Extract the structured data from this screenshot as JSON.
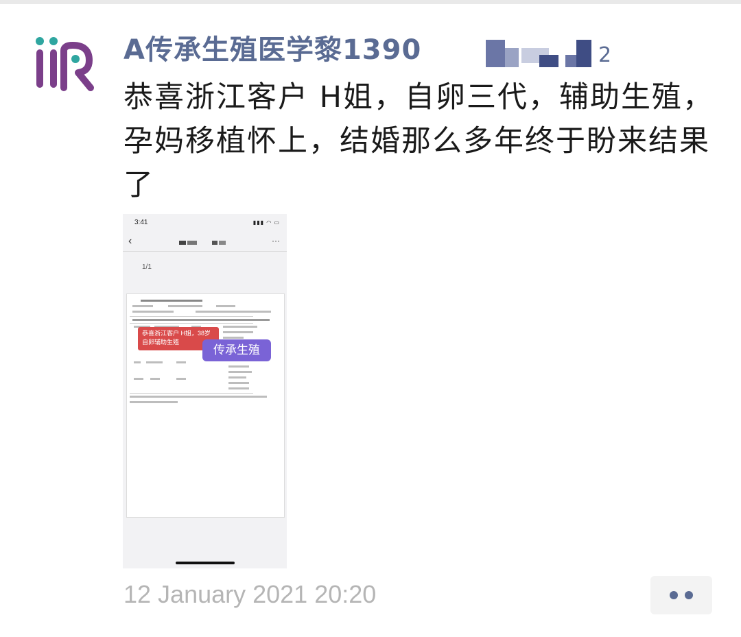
{
  "post": {
    "author": "A传承生殖医学黎1390",
    "text": "恭喜浙江客户 H姐，自卵三代，辅助生殖，孕妈移植怀上，结婚那么多年终于盼来结果了",
    "timestamp": "12 January 2021 20:20",
    "avatar_logo": "IIR"
  },
  "photo": {
    "status_time": "3:41",
    "page_indicator": "1/1",
    "red_tag": "恭喜浙江客户 H姐，38岁自卵辅助生殖",
    "purple_tag": "传承生殖"
  },
  "colors": {
    "author": "#5a6b93",
    "logo_purple": "#7b3f8a",
    "logo_teal": "#2fa6a0",
    "red_tag": "#d94a4a",
    "purple_tag": "#7a63d6"
  }
}
